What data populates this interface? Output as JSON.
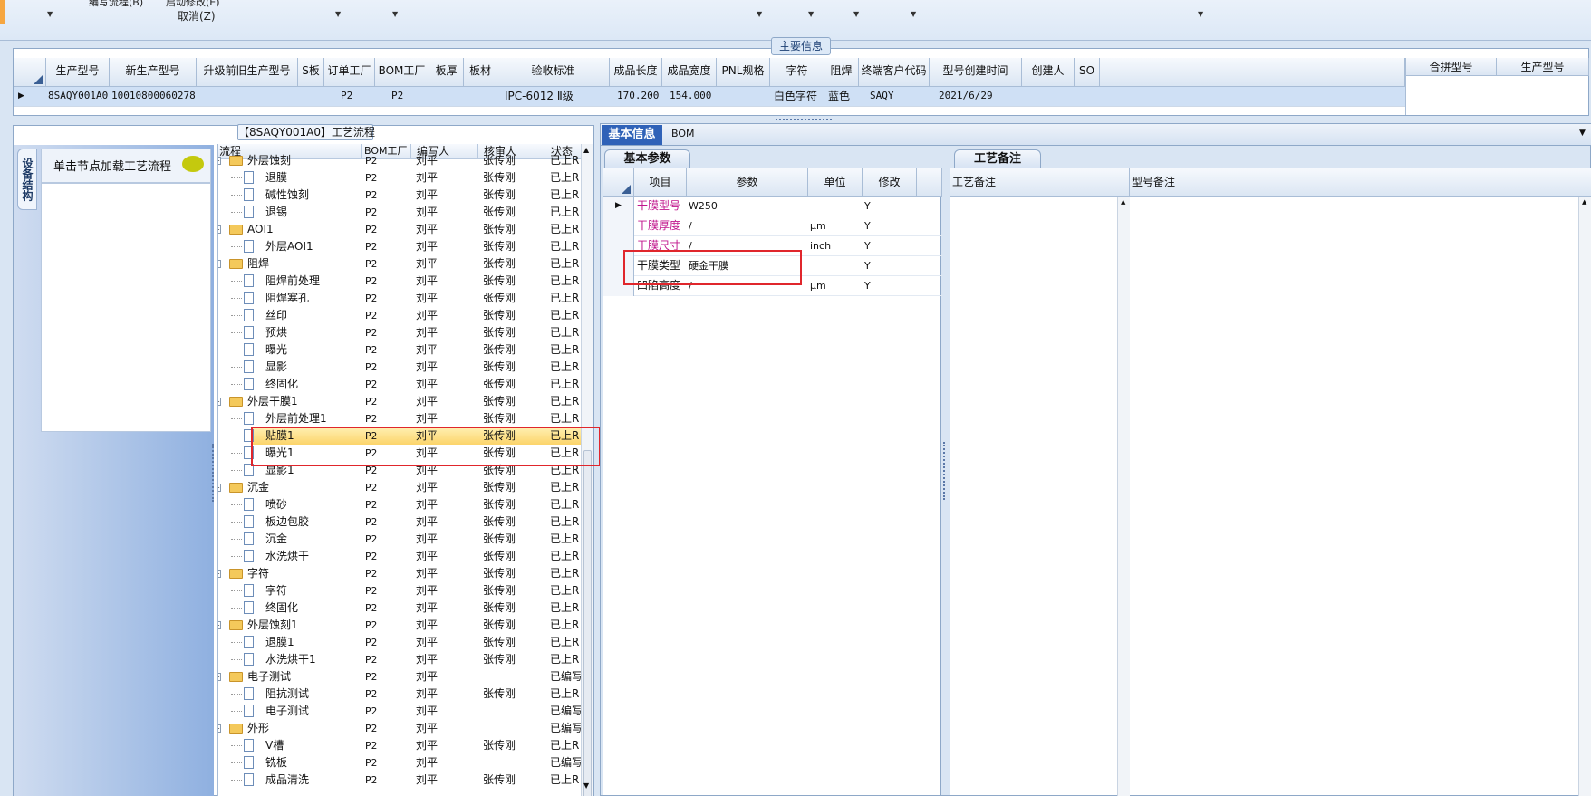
{
  "toolbar": {
    "cut1": "编写流程(B)",
    "cut2": "启动修改(E)",
    "cancel": "取消(Z)"
  },
  "main_info": {
    "title": "主要信息",
    "columns": [
      "生产型号",
      "新生产型号",
      "升级前旧生产型号",
      "S板",
      "订单工厂",
      "BOM工厂",
      "板厚",
      "板材",
      "验收标准",
      "成品长度",
      "成品宽度",
      "PNL规格",
      "字符",
      "阻焊",
      "终端客户代码",
      "型号创建时间",
      "创建人",
      "SO"
    ],
    "row": [
      "8SAQY001A0",
      "10010800060278",
      "",
      "",
      "P2",
      "P2",
      "",
      "",
      "IPC-6012 Ⅱ级",
      "170.200",
      "154.000",
      "",
      "白色字符",
      "蓝色",
      "SAQY",
      "2021/6/29",
      "",
      ""
    ],
    "right_columns": [
      "合拼型号",
      "生产型号"
    ]
  },
  "left": {
    "panel_title": "【8SAQY001A0】工艺流程",
    "side_tab": "设备结构",
    "tip": "单击节点加载工艺流程",
    "tree_headers": [
      "流程",
      "BOM工厂",
      "编写人",
      "核审人",
      "状态"
    ],
    "rows": [
      {
        "type": "folder",
        "name": "外层蚀刻",
        "bom": "P2",
        "writer": "刘平",
        "reviewer": "张传刚",
        "status": "已上R"
      },
      {
        "type": "doc",
        "name": "退膜",
        "bom": "P2",
        "writer": "刘平",
        "reviewer": "张传刚",
        "status": "已上R"
      },
      {
        "type": "doc",
        "name": "碱性蚀刻",
        "bom": "P2",
        "writer": "刘平",
        "reviewer": "张传刚",
        "status": "已上R"
      },
      {
        "type": "doc",
        "name": "退锡",
        "bom": "P2",
        "writer": "刘平",
        "reviewer": "张传刚",
        "status": "已上R"
      },
      {
        "type": "folder",
        "name": "AOI1",
        "bom": "P2",
        "writer": "刘平",
        "reviewer": "张传刚",
        "status": "已上R"
      },
      {
        "type": "doc",
        "name": "外层AOI1",
        "bom": "P2",
        "writer": "刘平",
        "reviewer": "张传刚",
        "status": "已上R"
      },
      {
        "type": "folder",
        "name": "阻焊",
        "bom": "P2",
        "writer": "刘平",
        "reviewer": "张传刚",
        "status": "已上R"
      },
      {
        "type": "doc",
        "name": "阻焊前处理",
        "bom": "P2",
        "writer": "刘平",
        "reviewer": "张传刚",
        "status": "已上R"
      },
      {
        "type": "doc",
        "name": "阻焊塞孔",
        "bom": "P2",
        "writer": "刘平",
        "reviewer": "张传刚",
        "status": "已上R"
      },
      {
        "type": "doc",
        "name": "丝印",
        "bom": "P2",
        "writer": "刘平",
        "reviewer": "张传刚",
        "status": "已上R"
      },
      {
        "type": "doc",
        "name": "预烘",
        "bom": "P2",
        "writer": "刘平",
        "reviewer": "张传刚",
        "status": "已上R"
      },
      {
        "type": "doc",
        "name": "曝光",
        "bom": "P2",
        "writer": "刘平",
        "reviewer": "张传刚",
        "status": "已上R"
      },
      {
        "type": "doc",
        "name": "显影",
        "bom": "P2",
        "writer": "刘平",
        "reviewer": "张传刚",
        "status": "已上R"
      },
      {
        "type": "doc",
        "name": "终固化",
        "bom": "P2",
        "writer": "刘平",
        "reviewer": "张传刚",
        "status": "已上R"
      },
      {
        "type": "folder",
        "name": "外层干膜1",
        "bom": "P2",
        "writer": "刘平",
        "reviewer": "张传刚",
        "status": "已上R"
      },
      {
        "type": "doc",
        "name": "外层前处理1",
        "bom": "P2",
        "writer": "刘平",
        "reviewer": "张传刚",
        "status": "已上R"
      },
      {
        "type": "doc",
        "name": "贴膜1",
        "bom": "P2",
        "writer": "刘平",
        "reviewer": "张传刚",
        "status": "已上R",
        "selected": true
      },
      {
        "type": "doc",
        "name": "曝光1",
        "bom": "P2",
        "writer": "刘平",
        "reviewer": "张传刚",
        "status": "已上R"
      },
      {
        "type": "doc",
        "name": "显影1",
        "bom": "P2",
        "writer": "刘平",
        "reviewer": "张传刚",
        "status": "已上R"
      },
      {
        "type": "folder",
        "name": "沉金",
        "bom": "P2",
        "writer": "刘平",
        "reviewer": "张传刚",
        "status": "已上R"
      },
      {
        "type": "doc",
        "name": "喷砂",
        "bom": "P2",
        "writer": "刘平",
        "reviewer": "张传刚",
        "status": "已上R"
      },
      {
        "type": "doc",
        "name": "板边包胶",
        "bom": "P2",
        "writer": "刘平",
        "reviewer": "张传刚",
        "status": "已上R"
      },
      {
        "type": "doc",
        "name": "沉金",
        "bom": "P2",
        "writer": "刘平",
        "reviewer": "张传刚",
        "status": "已上R"
      },
      {
        "type": "doc",
        "name": "水洗烘干",
        "bom": "P2",
        "writer": "刘平",
        "reviewer": "张传刚",
        "status": "已上R"
      },
      {
        "type": "folder",
        "name": "字符",
        "bom": "P2",
        "writer": "刘平",
        "reviewer": "张传刚",
        "status": "已上R"
      },
      {
        "type": "doc",
        "name": "字符",
        "bom": "P2",
        "writer": "刘平",
        "reviewer": "张传刚",
        "status": "已上R"
      },
      {
        "type": "doc",
        "name": "终固化",
        "bom": "P2",
        "writer": "刘平",
        "reviewer": "张传刚",
        "status": "已上R"
      },
      {
        "type": "folder",
        "name": "外层蚀刻1",
        "bom": "P2",
        "writer": "刘平",
        "reviewer": "张传刚",
        "status": "已上R"
      },
      {
        "type": "doc",
        "name": "退膜1",
        "bom": "P2",
        "writer": "刘平",
        "reviewer": "张传刚",
        "status": "已上R"
      },
      {
        "type": "doc",
        "name": "水洗烘干1",
        "bom": "P2",
        "writer": "刘平",
        "reviewer": "张传刚",
        "status": "已上R"
      },
      {
        "type": "folder",
        "name": "电子测试",
        "bom": "P2",
        "writer": "刘平",
        "reviewer": "",
        "status": "已编写"
      },
      {
        "type": "doc",
        "name": "阻抗测试",
        "bom": "P2",
        "writer": "刘平",
        "reviewer": "张传刚",
        "status": "已上R"
      },
      {
        "type": "doc",
        "name": "电子测试",
        "bom": "P2",
        "writer": "刘平",
        "reviewer": "",
        "status": "已编写"
      },
      {
        "type": "folder",
        "name": "外形",
        "bom": "P2",
        "writer": "刘平",
        "reviewer": "",
        "status": "已编写"
      },
      {
        "type": "doc",
        "name": "V槽",
        "bom": "P2",
        "writer": "刘平",
        "reviewer": "张传刚",
        "status": "已上R"
      },
      {
        "type": "doc",
        "name": "铣板",
        "bom": "P2",
        "writer": "刘平",
        "reviewer": "",
        "status": "已编写"
      },
      {
        "type": "doc",
        "name": "成品清洗",
        "bom": "P2",
        "writer": "刘平",
        "reviewer": "张传刚",
        "status": "已上R"
      }
    ]
  },
  "right": {
    "tabs": [
      "基本信息",
      "BOM"
    ],
    "param_tab": "基本参数",
    "note_tab": "工艺备注",
    "param_headers": [
      "项目",
      "参数",
      "单位",
      "修改"
    ],
    "params": [
      {
        "item": "干膜型号",
        "value": "W250",
        "unit": "",
        "mod": "Y",
        "color": "#c0148c"
      },
      {
        "item": "干膜厚度",
        "value": "/",
        "unit": "μm",
        "mod": "Y",
        "color": "#c0148c"
      },
      {
        "item": "干膜尺寸",
        "value": "/",
        "unit": "inch",
        "mod": "Y",
        "color": "#c0148c"
      },
      {
        "item": "干膜类型",
        "value": "硬金干膜",
        "unit": "",
        "mod": "Y",
        "color": "#111111"
      },
      {
        "item": "凹陷高度",
        "value": "/",
        "unit": "μm",
        "mod": "Y",
        "color": "#111111"
      }
    ],
    "note_headers": [
      "工艺备注",
      "型号备注"
    ]
  }
}
